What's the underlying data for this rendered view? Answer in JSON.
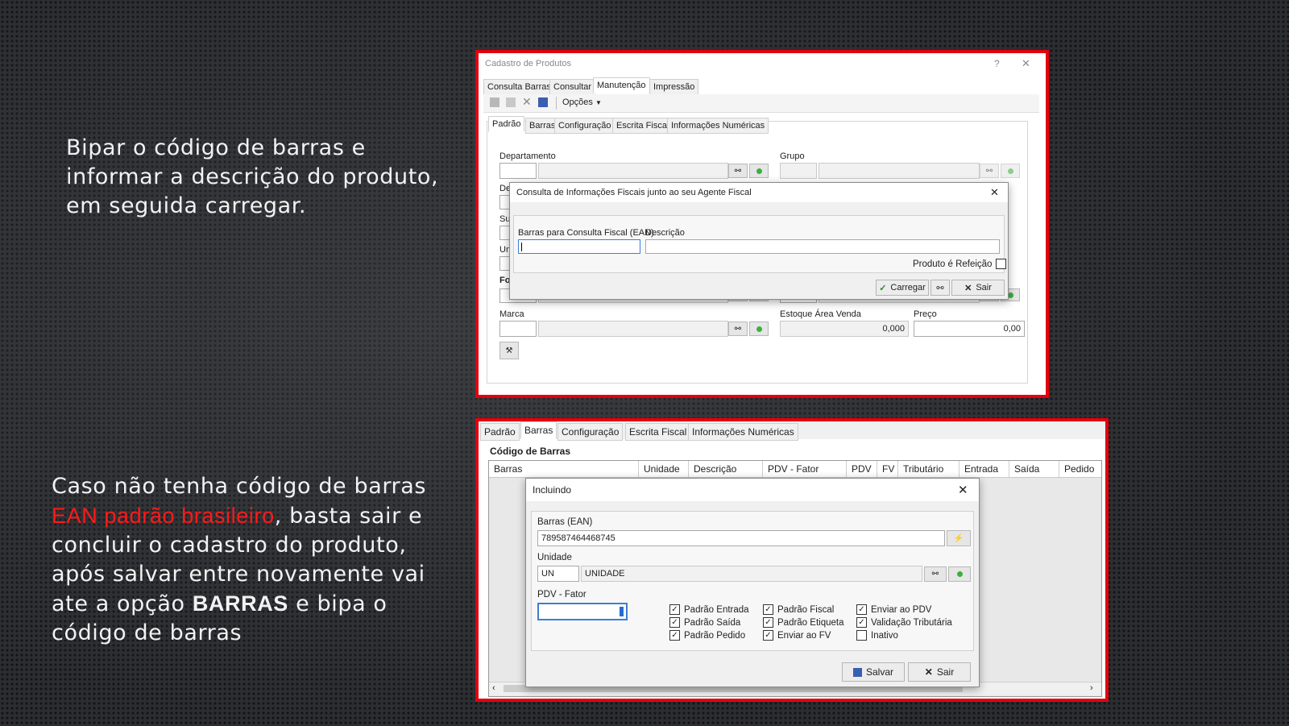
{
  "notes": {
    "top": "Bipar o código de barras e informar a descrição do produto, em seguida carregar.",
    "bottom": {
      "p1": "Caso não tenha código de barras",
      "red": "EAN padrão brasileiro",
      "p2": ", basta sair e concluir o cadastro do produto, após salvar entre novamente  vai ate a opção",
      "bold": "BARRAS",
      "p3": "e bipa o código de barras"
    }
  },
  "top_window": {
    "title": "Cadastro de Produtos",
    "help": "?",
    "close": "✕",
    "main_tabs": [
      "Consulta Barras",
      "Consultar",
      "Manutenção",
      "Impressão"
    ],
    "toolbar_options": "Opções",
    "sub_tabs": [
      "Padrão",
      "Barras",
      "Configuração",
      "Escrita Fiscal",
      "Informações Numéricas"
    ],
    "labels": {
      "departamento": "Departamento",
      "grupo": "Grupo",
      "de": "De",
      "su": "Sul",
      "un": "Un",
      "fo": "For",
      "marca": "Marca",
      "estoque": "Estoque Área Venda",
      "preco": "Preço"
    },
    "values": {
      "estoque": "0,000",
      "preco": "0,00"
    },
    "dialog": {
      "title": "Consulta de Informações Fiscais junto ao seu Agente Fiscal",
      "close": "✕",
      "ean_label": "Barras para Consulta Fiscal (EAN)",
      "desc_label": "Descrição",
      "refeicao_label": "Produto é Refeição",
      "carregar": "Carregar",
      "sair": "Sair"
    }
  },
  "bottom_window": {
    "tabs": [
      "Padrão",
      "Barras",
      "Configuração",
      "Escrita Fiscal",
      "Informações Numéricas"
    ],
    "section_title": "Código de Barras",
    "columns": [
      "Barras",
      "Unidade",
      "Descrição",
      "PDV - Fator",
      "PDV",
      "FV",
      "Tributário",
      "Entrada",
      "Saída",
      "Pedido"
    ],
    "dialog": {
      "title": "Incluindo",
      "close": "✕",
      "ean_label": "Barras (EAN)",
      "ean_value": "789587464468745",
      "unidade_label": "Unidade",
      "unidade_code": "UN",
      "unidade_desc": "UNIDADE",
      "fator_label": "PDV - Fator",
      "checks": [
        {
          "label": "Padrão Entrada",
          "checked": true
        },
        {
          "label": "Padrão Fiscal",
          "checked": true
        },
        {
          "label": "Enviar ao PDV",
          "checked": true
        },
        {
          "label": "Padrão Saída",
          "checked": true
        },
        {
          "label": "Padrão Etiqueta",
          "checked": true
        },
        {
          "label": "Validação Tributária",
          "checked": true
        },
        {
          "label": "Padrão Pedido",
          "checked": true
        },
        {
          "label": "Enviar ao FV",
          "checked": true
        },
        {
          "label": "Inativo",
          "checked": false
        }
      ],
      "salvar": "Salvar",
      "sair": "Sair"
    }
  }
}
